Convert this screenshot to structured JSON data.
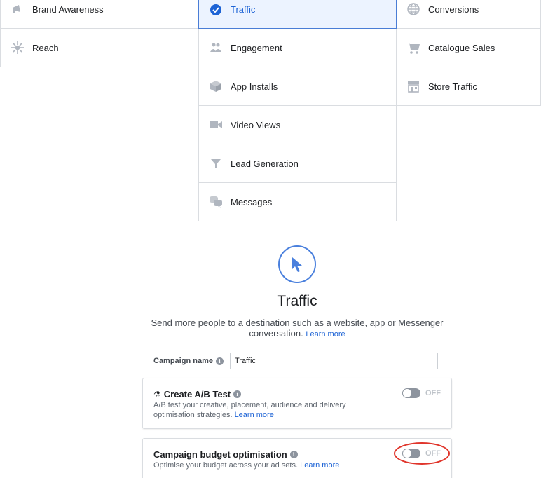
{
  "objectives": {
    "col0": [
      {
        "label": "Brand Awareness",
        "icon": "megaphone-icon"
      },
      {
        "label": "Reach",
        "icon": "reach-icon"
      }
    ],
    "col1": [
      {
        "label": "Traffic",
        "icon": "check-circle-icon",
        "selected": true
      },
      {
        "label": "Engagement",
        "icon": "people-icon"
      },
      {
        "label": "App Installs",
        "icon": "box-icon"
      },
      {
        "label": "Video Views",
        "icon": "video-camera-icon"
      },
      {
        "label": "Lead Generation",
        "icon": "funnel-icon"
      },
      {
        "label": "Messages",
        "icon": "chat-bubbles-icon"
      }
    ],
    "col2": [
      {
        "label": "Conversions",
        "icon": "globe-icon"
      },
      {
        "label": "Catalogue Sales",
        "icon": "cart-icon"
      },
      {
        "label": "Store Traffic",
        "icon": "store-icon"
      }
    ]
  },
  "detail": {
    "icon": "cursor-icon",
    "title": "Traffic",
    "description": "Send more people to a destination such as a website, app or Messenger conversation.",
    "learn_more": "Learn more"
  },
  "campaign_name": {
    "label": "Campaign name",
    "value": "Traffic"
  },
  "ab_test": {
    "title": "Create A/B Test",
    "description": "A/B test your creative, placement, audience and delivery optimisation strategies.",
    "learn_more": "Learn more",
    "toggle_label": "OFF"
  },
  "cbo": {
    "title": "Campaign budget optimisation",
    "description": "Optimise your budget across your ad sets.",
    "learn_more": "Learn more",
    "toggle_label": "OFF"
  },
  "colors": {
    "accent": "#1d63d5",
    "selected_bg": "#ecf3ff",
    "annotation": "#e0352b"
  }
}
